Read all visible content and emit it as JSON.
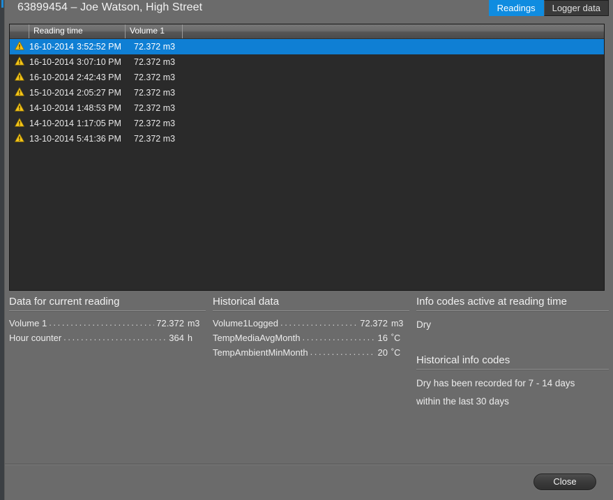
{
  "window": {
    "title": "63899454 – Joe Watson, High Street"
  },
  "tabs": [
    {
      "label": "Readings",
      "active": true
    },
    {
      "label": "Logger data",
      "active": false
    }
  ],
  "table": {
    "columns": [
      "",
      "Reading time",
      "Volume 1",
      ""
    ],
    "rows": [
      {
        "icon": "warning-icon",
        "date": "16-10-2014",
        "time": "3:52:52 PM",
        "volume": "72.372 m3",
        "selected": true
      },
      {
        "icon": "warning-icon",
        "date": "16-10-2014",
        "time": "3:07:10 PM",
        "volume": "72.372 m3",
        "selected": false
      },
      {
        "icon": "warning-icon",
        "date": "16-10-2014",
        "time": "2:42:43 PM",
        "volume": "72.372 m3",
        "selected": false
      },
      {
        "icon": "warning-icon",
        "date": "15-10-2014",
        "time": "2:05:27 PM",
        "volume": "72.372 m3",
        "selected": false
      },
      {
        "icon": "warning-icon",
        "date": "14-10-2014",
        "time": "1:48:53 PM",
        "volume": "72.372 m3",
        "selected": false
      },
      {
        "icon": "warning-icon",
        "date": "14-10-2014",
        "time": "1:17:05 PM",
        "volume": "72.372 m3",
        "selected": false
      },
      {
        "icon": "warning-icon",
        "date": "13-10-2014",
        "time": "5:41:36 PM",
        "volume": "72.372 m3",
        "selected": false
      }
    ]
  },
  "current_reading": {
    "title": "Data for current reading",
    "items": [
      {
        "label": "Volume 1",
        "value": "72.372",
        "unit": "m3"
      },
      {
        "label": "Hour counter",
        "value": "364",
        "unit": "h"
      }
    ]
  },
  "historical_data": {
    "title": "Historical data",
    "items": [
      {
        "label": "Volume1Logged",
        "value": "72.372",
        "unit": "m3"
      },
      {
        "label": "TempMediaAvgMonth",
        "value": "16",
        "unit": "˚C"
      },
      {
        "label": "TempAmbientMinMonth",
        "value": "20",
        "unit": "˚C"
      }
    ]
  },
  "info_codes": {
    "active_title": "Info codes active at reading time",
    "active_items": [
      "Dry"
    ],
    "historical_title": "Historical info codes",
    "historical_items": [
      "Dry has been recorded for 7 - 14 days",
      "within the last 30 days"
    ]
  },
  "footer": {
    "close_label": "Close"
  },
  "colors": {
    "accent_blue": "#0f8ce0",
    "selection_blue": "#0f7fd4",
    "warning_yellow": "#f5c518",
    "panel_gray": "#6b6b6b",
    "table_bg": "#2a2a2a"
  }
}
